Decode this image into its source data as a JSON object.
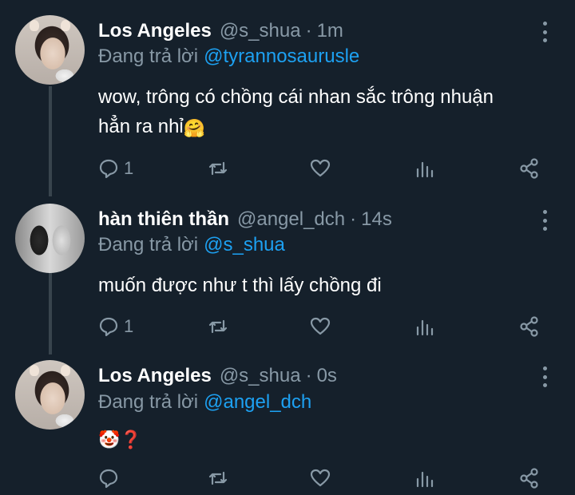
{
  "tweets": [
    {
      "name": "Los Angeles",
      "handle": "@s_shua",
      "time": "1m",
      "reply_prefix": "Đang trả lời",
      "reply_to": "@tyrannosaurusle",
      "text_line1": "wow, trông có chồng cái nhan sắc trông nhuận",
      "text_line2": "hẳn ra nhỉ",
      "emoji": "🤗",
      "reply_count": "1"
    },
    {
      "name": "hàn thiên thần",
      "handle": "@angel_dch",
      "time": "14s",
      "reply_prefix": "Đang trả lời",
      "reply_to": "@s_shua",
      "text_line1": "muốn được như t thì lấy chồng đi",
      "reply_count": "1"
    },
    {
      "name": "Los Angeles",
      "handle": "@s_shua",
      "time": "0s",
      "reply_prefix": "Đang trả lời",
      "reply_to": "@angel_dch",
      "emoji": "🤡❓",
      "reply_count": ""
    }
  ],
  "separator": "·",
  "icons": [
    "reply-icon",
    "retweet-icon",
    "like-icon",
    "analytics-icon",
    "share-icon",
    "more-options-icon"
  ],
  "colors": {
    "background": "#15202b",
    "text": "#ffffff",
    "secondary": "#8899a6",
    "link": "#1da1f2"
  }
}
